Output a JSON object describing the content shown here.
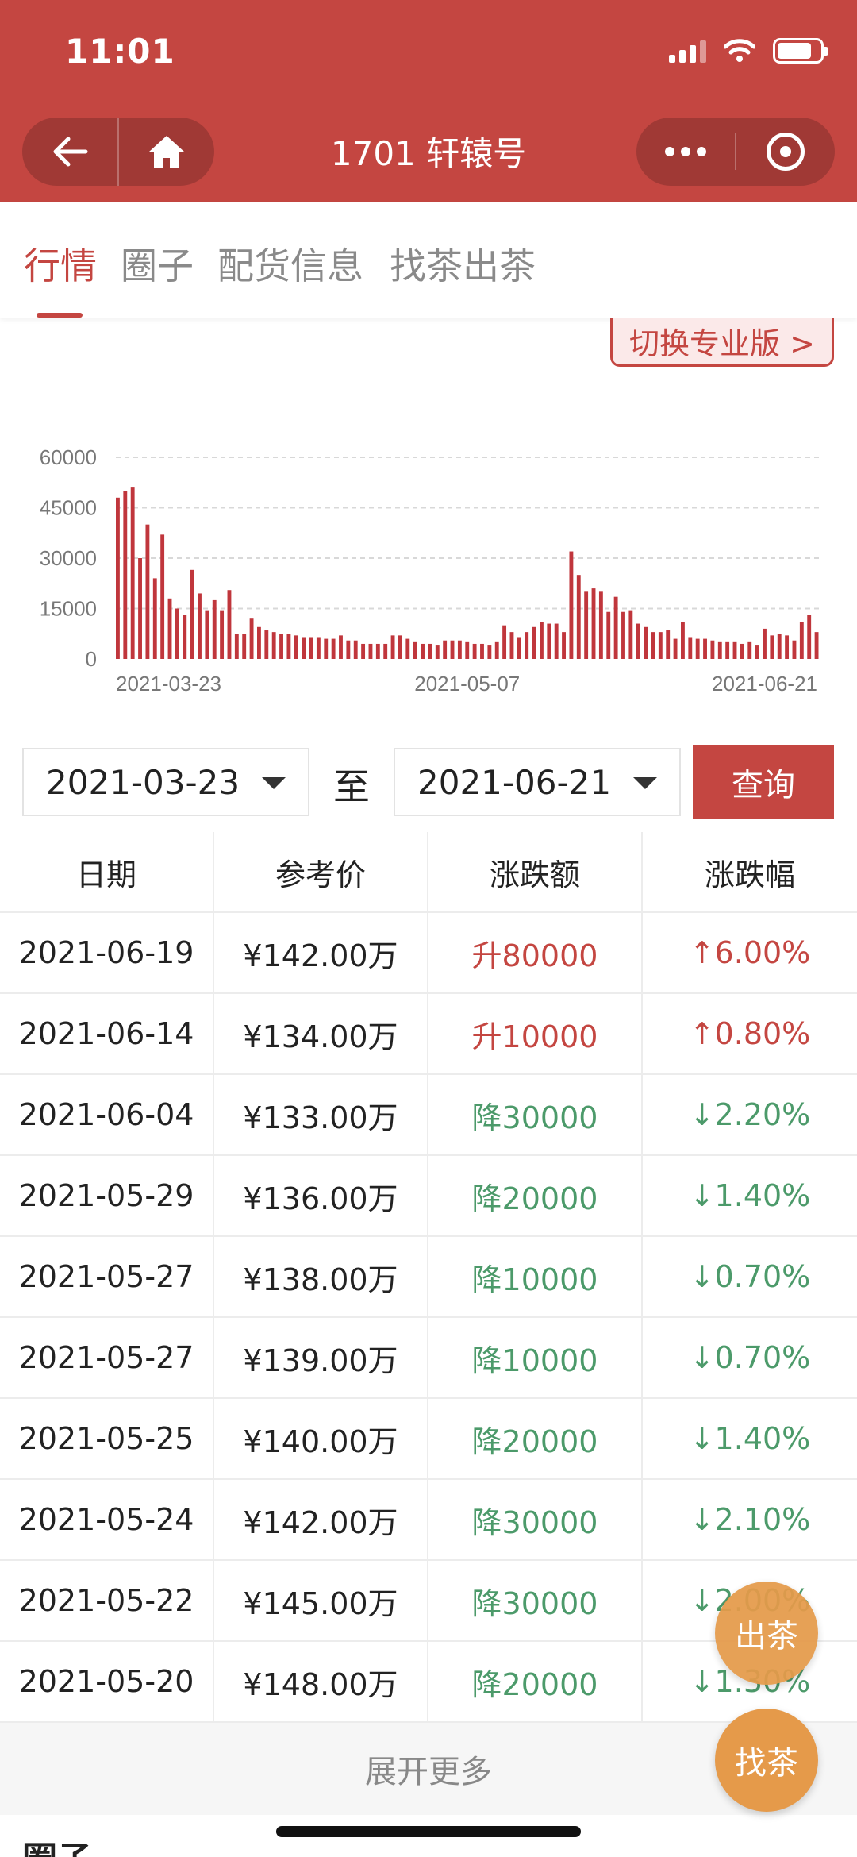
{
  "status_bar": {
    "time": "11:01"
  },
  "nav": {
    "title": "1701 轩辕号"
  },
  "tabs": [
    {
      "label": "行情",
      "active": true
    },
    {
      "label": "圈子",
      "active": false
    },
    {
      "label": "配货信息",
      "active": false
    },
    {
      "label": "找茶出茶",
      "active": false
    }
  ],
  "pro_switch_label": "切换专业版 >",
  "chart_data": {
    "type": "bar",
    "title": "",
    "xlabel": "",
    "ylabel": "",
    "ylim": [
      0,
      60000
    ],
    "yticks": [
      "60000",
      "45000",
      "30000",
      "15000",
      "0"
    ],
    "xticks": [
      "2021-03-23",
      "2021-05-07",
      "2021-06-21"
    ],
    "grid": true,
    "color": "#c0363c",
    "values": [
      48000,
      50000,
      51000,
      30000,
      40000,
      24000,
      37000,
      18000,
      15000,
      13000,
      26500,
      19500,
      14500,
      17500,
      14500,
      20500,
      7500,
      7500,
      12000,
      9500,
      8500,
      8000,
      7500,
      7500,
      7000,
      6500,
      6500,
      6500,
      6000,
      6000,
      7000,
      5500,
      5500,
      4500,
      4500,
      4500,
      4500,
      7000,
      7000,
      6000,
      5000,
      4500,
      4500,
      4000,
      5500,
      5500,
      5500,
      5000,
      4500,
      4500,
      4000,
      5000,
      10000,
      8000,
      6500,
      8000,
      9500,
      11000,
      10500,
      10500,
      8000,
      32000,
      25000,
      20000,
      21000,
      20000,
      14000,
      18500,
      14000,
      14500,
      10500,
      9500,
      8000,
      8000,
      8500,
      6000,
      11000,
      6500,
      6000,
      6000,
      5500,
      5000,
      5000,
      5000,
      4500,
      5000,
      4000,
      9000,
      7000,
      7500,
      7000,
      5500,
      11000,
      13000,
      8000
    ]
  },
  "query": {
    "start_date": "2021-03-23",
    "to_label": "至",
    "end_date": "2021-06-21",
    "button_label": "查询"
  },
  "table": {
    "headers": [
      "日期",
      "参考价",
      "涨跌额",
      "涨跌幅"
    ],
    "rows": [
      {
        "date": "2021-06-19",
        "price": "¥142.00万",
        "change": "升80000",
        "pct": "↑6.00%",
        "dir": "up"
      },
      {
        "date": "2021-06-14",
        "price": "¥134.00万",
        "change": "升10000",
        "pct": "↑0.80%",
        "dir": "up"
      },
      {
        "date": "2021-06-04",
        "price": "¥133.00万",
        "change": "降30000",
        "pct": "↓2.20%",
        "dir": "down"
      },
      {
        "date": "2021-05-29",
        "price": "¥136.00万",
        "change": "降20000",
        "pct": "↓1.40%",
        "dir": "down"
      },
      {
        "date": "2021-05-27",
        "price": "¥138.00万",
        "change": "降10000",
        "pct": "↓0.70%",
        "dir": "down"
      },
      {
        "date": "2021-05-27",
        "price": "¥139.00万",
        "change": "降10000",
        "pct": "↓0.70%",
        "dir": "down"
      },
      {
        "date": "2021-05-25",
        "price": "¥140.00万",
        "change": "降20000",
        "pct": "↓1.40%",
        "dir": "down"
      },
      {
        "date": "2021-05-24",
        "price": "¥142.00万",
        "change": "降30000",
        "pct": "↓2.10%",
        "dir": "down"
      },
      {
        "date": "2021-05-22",
        "price": "¥145.00万",
        "change": "降30000",
        "pct": "↓2.00%",
        "dir": "down"
      },
      {
        "date": "2021-05-20",
        "price": "¥148.00万",
        "change": "降20000",
        "pct": "↓1.30%",
        "dir": "down"
      }
    ]
  },
  "expand_more_label": "展开更多",
  "next_section_title": "圈子",
  "fab": {
    "sell_label": "出茶",
    "find_label": "找茶"
  },
  "colors": {
    "brand": "#c44641",
    "up": "#c44641",
    "down": "#4c9a6a",
    "fab": "#e59a4a"
  }
}
